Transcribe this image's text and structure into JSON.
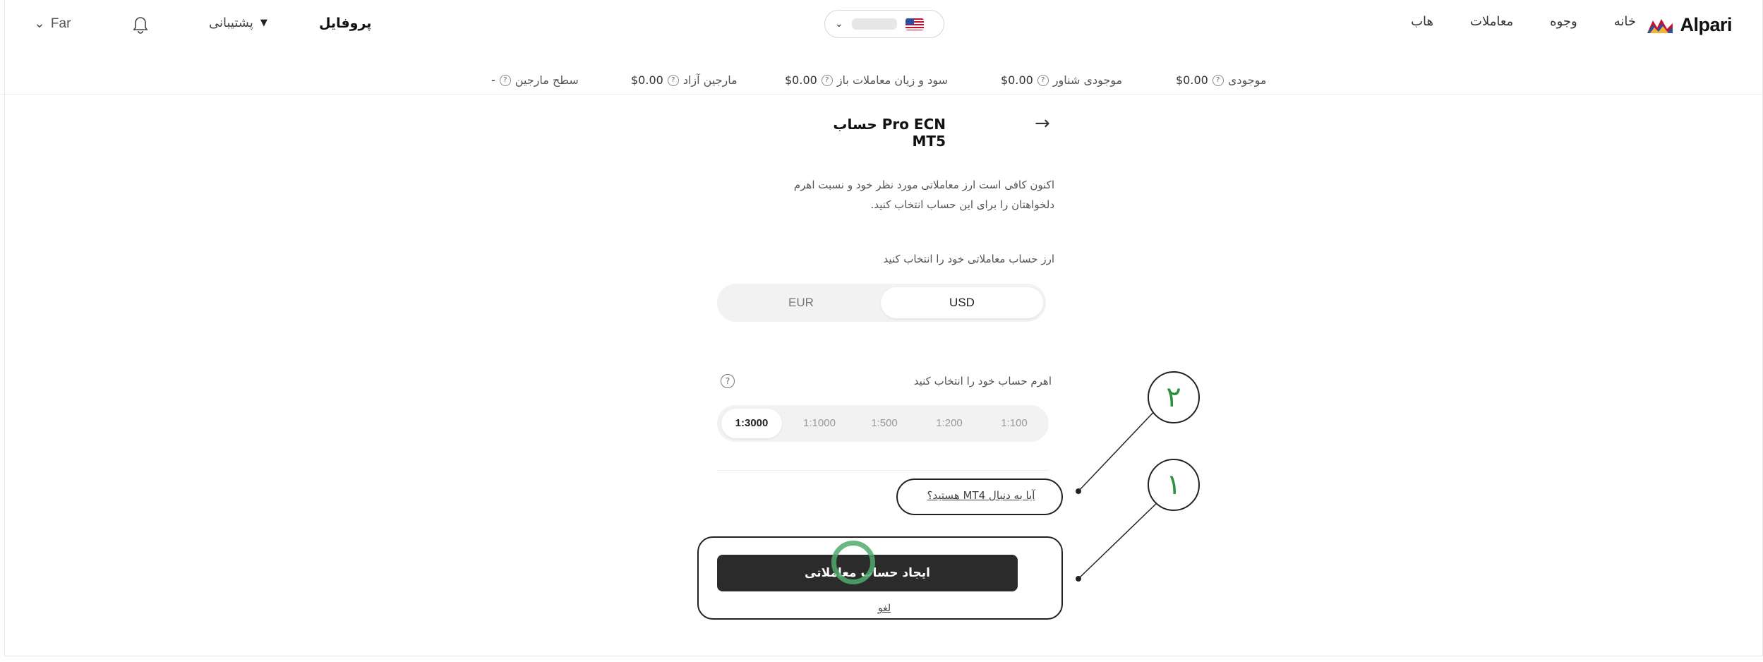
{
  "nav": {
    "brand": "Alpari",
    "items": [
      "خانه",
      "وجوه",
      "معاملات",
      "هاب"
    ],
    "profile": "پروفایل",
    "support": "پشتیبانی",
    "language": "Far"
  },
  "stats": [
    {
      "label": "موجودی",
      "value": "$0.00"
    },
    {
      "label": "موجودی شناور",
      "value": "$0.00"
    },
    {
      "label": "سود و زیان معاملات باز",
      "value": "$0.00"
    },
    {
      "label": "مارجین آزاد",
      "value": "$0.00"
    },
    {
      "label": "سطح مارجین",
      "value": "-"
    }
  ],
  "form": {
    "title": "حساب Pro ECN MT5",
    "intro": "اکنون کافی است ارز معاملاتی مورد نظر خود و نسبت اهرم دلخواهتان را برای این حساب انتخاب کنید.",
    "currency_label": "ارز حساب معاملاتی خود را انتخاب کنید",
    "currencies": [
      "USD",
      "EUR"
    ],
    "selected_currency": "USD",
    "leverage_label": "اهرم حساب خود را انتخاب کنید",
    "leverages": [
      "1:100",
      "1:200",
      "1:500",
      "1:1000",
      "1:3000"
    ],
    "selected_leverage": "1:3000",
    "mt4_link": "آیا به دنبال MT4 هستید؟",
    "create_button": "ایجاد حساب معاملاتی",
    "cancel": "لغو"
  },
  "annotations": [
    "۱",
    "۲"
  ],
  "colors": {
    "primary_button": "#2b2b2b",
    "annotation_digit": "#2f8f3e",
    "cursor_ring": "#50aa6e"
  }
}
